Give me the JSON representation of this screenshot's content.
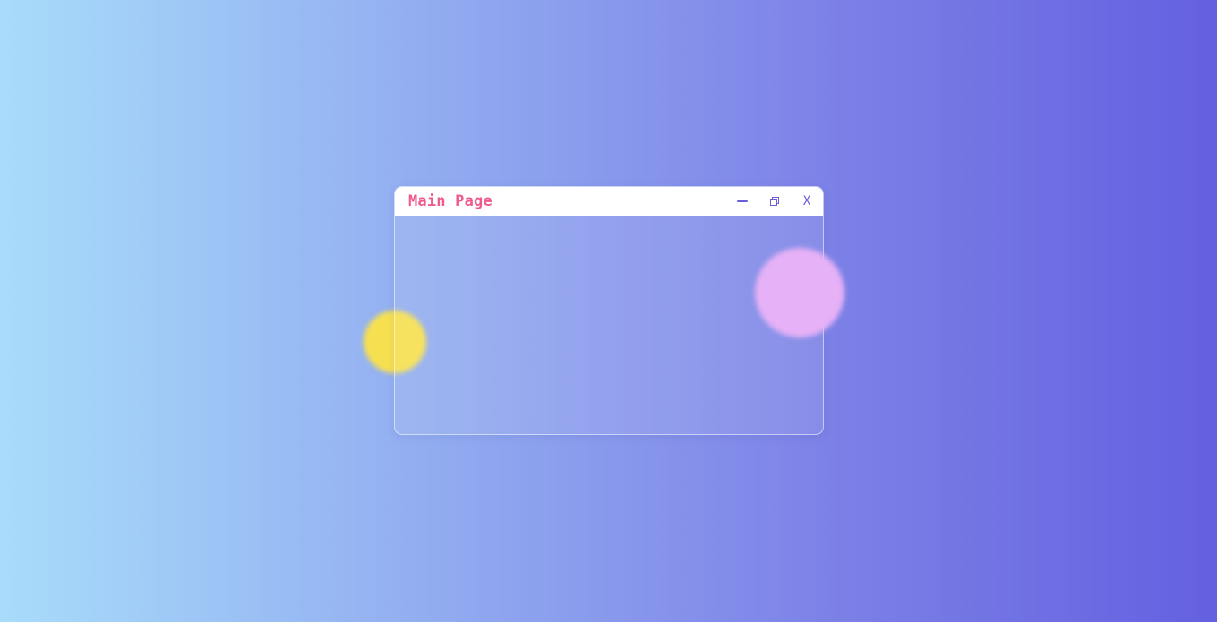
{
  "window": {
    "title": "Main Page",
    "controls": {
      "minimize_icon": "minimize-icon",
      "maximize_icon": "restore-icon",
      "close_label": "X"
    }
  },
  "colors": {
    "background_start": "#a8dcfa",
    "background_end": "#6460e0",
    "title_text": "#ee5b8e",
    "control_icons": "#6a5fd8",
    "titlebar": "#ffffff",
    "blob_yellow": "#f7e04f",
    "blob_pink": "#e6b1f6"
  }
}
